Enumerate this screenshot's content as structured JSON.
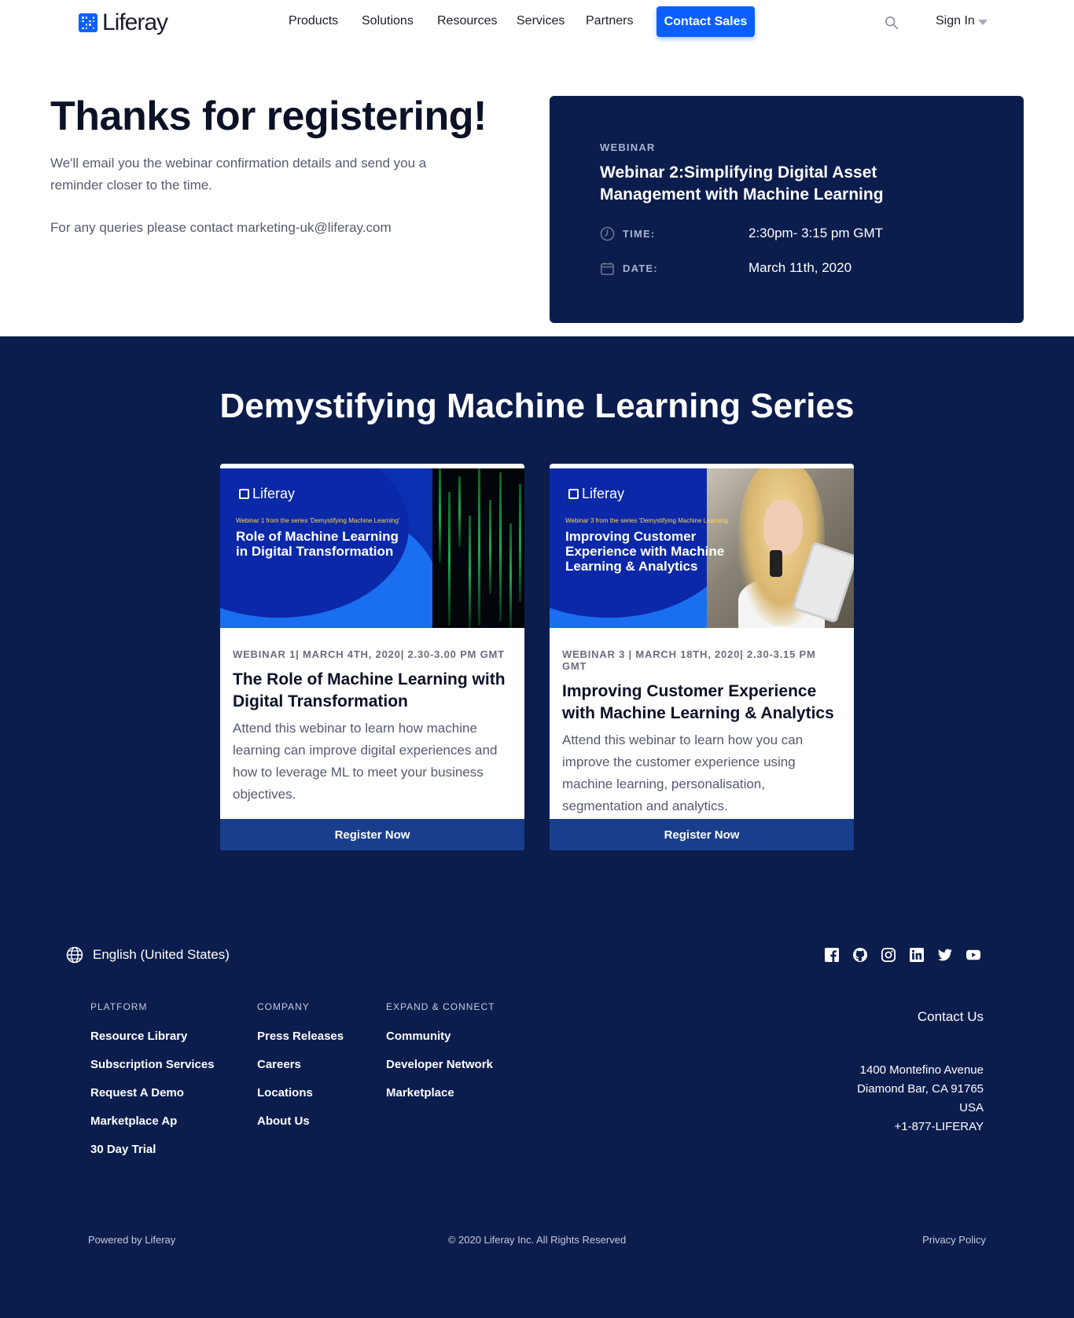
{
  "header": {
    "logo_text": "Liferay",
    "nav": [
      "Products",
      "Solutions",
      "Resources",
      "Services",
      "Partners"
    ],
    "contact_sales": "Contact Sales",
    "sign_in": "Sign In"
  },
  "hero": {
    "title": "Thanks for registering!",
    "description": "We'll email you the webinar confirmation details and send you a reminder closer to the time.",
    "contact": "For any queries please contact marketing-uk@liferay.com"
  },
  "webinar_card": {
    "eyebrow": "WEBINAR",
    "title": "Webinar 2:Simplifying Digital Asset Management with Machine Learning",
    "time_label": "TIME:",
    "time_value": "2:30pm- 3:15 pm GMT",
    "date_label": "DATE:",
    "date_value": "March 11th, 2020"
  },
  "series": {
    "title": "Demystifying Machine Learning Series",
    "cards": [
      {
        "image_logo": "Liferay",
        "image_subtitle": "Webinar 1 from the series 'Demystifying Machine Learning'",
        "image_title": "Role of Machine Learning in Digital Transformation",
        "meta": "WEBINAR 1| MARCH 4TH, 2020| 2.30-3.00 PM GMT",
        "title": "The Role of Machine Learning with Digital Transformation",
        "description": "Attend this webinar to learn how machine learning can improve digital experiences and how to leverage ML to meet your business objectives.",
        "button": "Register Now"
      },
      {
        "image_logo": "Liferay",
        "image_subtitle": "Webinar 3 from the series 'Demystifying Machine Learning",
        "image_title": "Improving Customer Experience with Machine Learning & Analytics",
        "meta": "WEBINAR 3 | MARCH 18TH, 2020| 2.30-3.15 PM GMT",
        "title": "Improving Customer Experience with Machine Learning & Analytics",
        "description": "Attend this webinar to learn how you can improve the customer experience using machine learning, personalisation, segmentation and analytics.",
        "button": "Register Now"
      }
    ]
  },
  "footer": {
    "language": "English (United States)",
    "social_icons": [
      "facebook-icon",
      "github-icon",
      "instagram-icon",
      "linkedin-icon",
      "twitter-icon",
      "youtube-icon"
    ],
    "columns": [
      {
        "heading": "PLATFORM",
        "links": [
          "Resource Library",
          "Subscription Services",
          "Request A Demo",
          "Marketplace Ap",
          "30 Day Trial"
        ]
      },
      {
        "heading": "COMPANY",
        "links": [
          "Press Releases",
          "Careers",
          "Locations",
          "About Us"
        ]
      },
      {
        "heading": "EXPAND & CONNECT",
        "links": [
          "Community",
          "Developer Network",
          "Marketplace"
        ]
      }
    ],
    "contact_us": "Contact Us",
    "address": [
      "1400 Montefino Avenue",
      "Diamond Bar, CA 91765",
      "USA",
      "+1-877-LIFERAY"
    ],
    "powered_by": "Powered by Liferay",
    "copyright": "© 2020 Liferay Inc. All Rights Reserved",
    "privacy": "Privacy Policy"
  },
  "colors": {
    "brand_blue": "#0b5fff",
    "navy": "#0b1d4d",
    "button_blue": "#1a3e8e"
  }
}
